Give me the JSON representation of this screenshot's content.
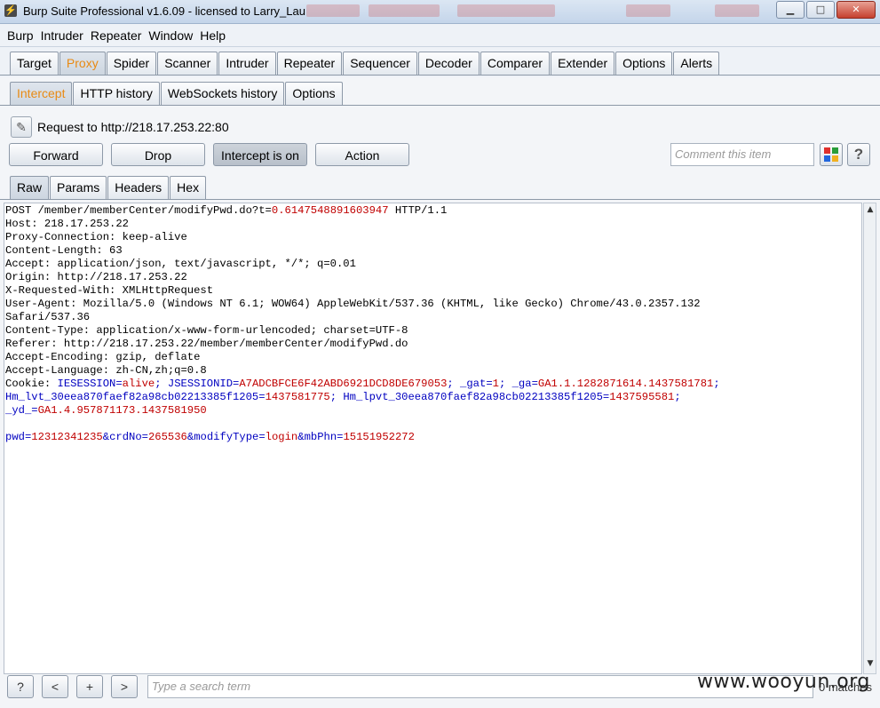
{
  "window": {
    "title": "Burp Suite Professional v1.6.09 - licensed to Larry_Lau",
    "min": "▁",
    "max": "□",
    "close": "✕"
  },
  "menu": [
    "Burp",
    "Intruder",
    "Repeater",
    "Window",
    "Help"
  ],
  "main_tabs": [
    "Target",
    "Proxy",
    "Spider",
    "Scanner",
    "Intruder",
    "Repeater",
    "Sequencer",
    "Decoder",
    "Comparer",
    "Extender",
    "Options",
    "Alerts"
  ],
  "main_tabs_active": "Proxy",
  "proxy_tabs": [
    "Intercept",
    "HTTP history",
    "WebSockets history",
    "Options"
  ],
  "proxy_tabs_active": "Intercept",
  "request_label": "Request to http://218.17.253.22:80",
  "buttons": {
    "forward": "Forward",
    "drop": "Drop",
    "intercept": "Intercept is on",
    "action": "Action"
  },
  "comment_placeholder": "Comment this item",
  "help_label": "?",
  "edit_icon": "pencil-icon",
  "highlight_colors": [
    "#e0302c",
    "#2a9d3a",
    "#2266dd",
    "#f0b020"
  ],
  "view_tabs": [
    "Raw",
    "Params",
    "Headers",
    "Hex"
  ],
  "view_tabs_active": "Raw",
  "request_lines": [
    [
      {
        "t": "POST /member/memberCenter/modifyPwd.do?t="
      },
      {
        "t": "0.6147548891603947",
        "c": "pval"
      },
      {
        "t": " HTTP/1.1"
      }
    ],
    [
      {
        "t": "Host: 218.17.253.22"
      }
    ],
    [
      {
        "t": "Proxy-Connection: keep-alive"
      }
    ],
    [
      {
        "t": "Content-Length: 63"
      }
    ],
    [
      {
        "t": "Accept: application/json, text/javascript, */*; q=0.01"
      }
    ],
    [
      {
        "t": "Origin: http://218.17.253.22"
      }
    ],
    [
      {
        "t": "X-Requested-With: XMLHttpRequest"
      }
    ],
    [
      {
        "t": "User-Agent: Mozilla/5.0 (Windows NT 6.1; WOW64) AppleWebKit/537.36 (KHTML, like Gecko) Chrome/43.0.2357.132"
      }
    ],
    [
      {
        "t": "Safari/537.36"
      }
    ],
    [
      {
        "t": "Content-Type: application/x-www-form-urlencoded; charset=UTF-8"
      }
    ],
    [
      {
        "t": "Referer: http://218.17.253.22/member/memberCenter/modifyPwd.do"
      }
    ],
    [
      {
        "t": "Accept-Encoding: gzip, deflate"
      }
    ],
    [
      {
        "t": "Accept-Language: zh-CN,zh;q=0.8"
      }
    ],
    [
      {
        "t": "Cookie: "
      },
      {
        "t": "IESESSION",
        "c": "pname"
      },
      {
        "t": "=",
        "c": "pname"
      },
      {
        "t": "alive",
        "c": "pval"
      },
      {
        "t": "; ",
        "c": "pname"
      },
      {
        "t": "JSESSIONID",
        "c": "pname"
      },
      {
        "t": "=",
        "c": "pname"
      },
      {
        "t": "A7ADCBFCE6F42ABD6921DCD8DE679053",
        "c": "pval"
      },
      {
        "t": "; ",
        "c": "pname"
      },
      {
        "t": "_gat",
        "c": "pname"
      },
      {
        "t": "=",
        "c": "pname"
      },
      {
        "t": "1",
        "c": "pval"
      },
      {
        "t": "; ",
        "c": "pname"
      },
      {
        "t": "_ga",
        "c": "pname"
      },
      {
        "t": "=",
        "c": "pname"
      },
      {
        "t": "GA1.1.1282871614.1437581781",
        "c": "pval"
      },
      {
        "t": ";",
        "c": "pname"
      }
    ],
    [
      {
        "t": "Hm_lvt_30eea870faef82a98cb02213385f1205",
        "c": "pname"
      },
      {
        "t": "=",
        "c": "pname"
      },
      {
        "t": "1437581775",
        "c": "pval"
      },
      {
        "t": "; ",
        "c": "pname"
      },
      {
        "t": "Hm_lpvt_30eea870faef82a98cb02213385f1205",
        "c": "pname"
      },
      {
        "t": "=",
        "c": "pname"
      },
      {
        "t": "1437595581",
        "c": "pval"
      },
      {
        "t": ";",
        "c": "pname"
      }
    ],
    [
      {
        "t": "_yd_",
        "c": "pname"
      },
      {
        "t": "=",
        "c": "pname"
      },
      {
        "t": "GA1.4.957871173.1437581950",
        "c": "pval"
      }
    ],
    [
      {
        "t": ""
      }
    ],
    [
      {
        "t": "pwd",
        "c": "pname"
      },
      {
        "t": "=",
        "c": "pname"
      },
      {
        "t": "12312341235",
        "c": "pval"
      },
      {
        "t": "&",
        "c": "pname"
      },
      {
        "t": "crdNo",
        "c": "pname"
      },
      {
        "t": "=",
        "c": "pname"
      },
      {
        "t": "265536",
        "c": "pval"
      },
      {
        "t": "&",
        "c": "pname"
      },
      {
        "t": "modifyType",
        "c": "pname"
      },
      {
        "t": "=",
        "c": "pname"
      },
      {
        "t": "login",
        "c": "pval"
      },
      {
        "t": "&",
        "c": "pname"
      },
      {
        "t": "mbPhn",
        "c": "pname"
      },
      {
        "t": "=",
        "c": "pname"
      },
      {
        "t": "15151952272",
        "c": "pval"
      }
    ]
  ],
  "scroll": {
    "up": "▲",
    "down": "▼"
  },
  "bottom": {
    "help": "?",
    "prev": "<",
    "add": "+",
    "next": ">",
    "search_placeholder": "Type a search term",
    "matches": "0 matches"
  },
  "watermark": "www.wooyun.org"
}
